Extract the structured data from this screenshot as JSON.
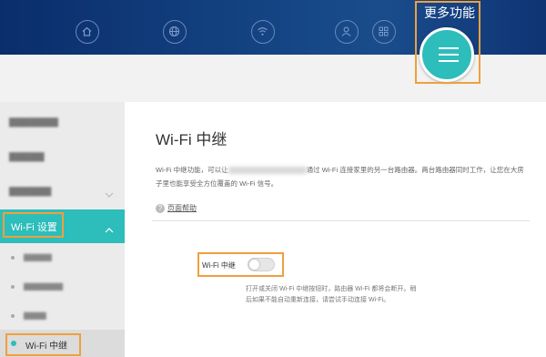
{
  "topnav": {
    "more_label": "更多功能"
  },
  "page": {
    "title": "Wi-Fi 中继",
    "desc_part1": "Wi-Fi 中继功能，可以让",
    "desc_part2": "通过 Wi-Fi 连接家里的另一台路由器。两台路由器同时工作，让您在大房子里也能享受全方位覆盖的 Wi-Fi 信号。",
    "help_link": "页面帮助"
  },
  "sidebar": {
    "active_section": "Wi-Fi 设置",
    "current_item": "Wi-Fi 中继"
  },
  "settings": {
    "toggle_label": "Wi-Fi 中继",
    "toggle_on": false,
    "note": "打开或关闭 Wi-Fi 中继按钮时，路由器 Wi-Fi 都将会断开。稍后如果不能自动重新连接，请尝试手动连接 Wi-Fi。"
  },
  "colors": {
    "accent": "#2dbdbb",
    "highlight_box": "#f0a03c",
    "topbar": "#12407f"
  }
}
